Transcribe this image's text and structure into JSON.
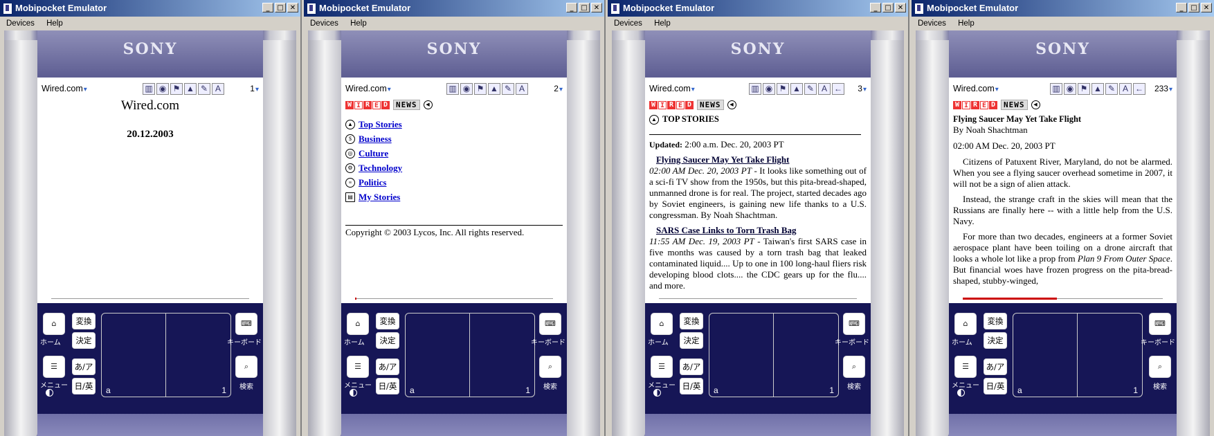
{
  "window_title": "Mobipocket Emulator",
  "window_controls": {
    "minimize": "_",
    "maximize": "□",
    "close": "✕"
  },
  "menu": [
    "Devices",
    "Help"
  ],
  "device_brand": "SONY",
  "book_title": "Wired.com",
  "pad": {
    "home": "ホーム",
    "convert": "変換",
    "decide": "決定",
    "keyboard": "キーボード",
    "kana": "あ/ア",
    "menu": "メニュー",
    "jp_en": "日/英",
    "search": "検索",
    "graffiti_left": "a",
    "graffiti_right": "1"
  },
  "screens": [
    {
      "page_num": "1",
      "cover_title": "Wired.com",
      "cover_date": "20.12.2003",
      "progress": 0.0
    },
    {
      "page_num": "2",
      "wired_letters": [
        "W",
        "I",
        "R",
        "E",
        "D"
      ],
      "news_label": "NEWS",
      "nav_items": [
        "Top Stories",
        "Business",
        "Culture",
        "Technology",
        "Politics",
        "My Stories"
      ],
      "copyright": "Copyright © 2003 Lycos, Inc. All rights reserved.",
      "progress": 0.005
    },
    {
      "page_num": "3",
      "news_label": "NEWS",
      "section_title": "TOP STORIES",
      "updated_label": "Updated:",
      "updated_value": "2:00 a.m. Dec. 20, 2003 PT",
      "stories": [
        {
          "headline": "Flying Saucer May Yet Take Flight",
          "time": "02:00 AM Dec. 20, 2003 PT",
          "text": " - It looks like something out of a sci-fi TV show from the 1950s, but this pita-bread-shaped, unmanned drone is for real. The project, started decades ago by Soviet engineers, is gaining new life thanks to a U.S. congressman. By Noah Shachtman."
        },
        {
          "headline": "SARS Case Links to Torn Trash Bag",
          "time": "11:55 AM Dec. 19, 2003 PT",
          "text": " - Taiwan's first SARS case in five months was caused by a torn trash bag that leaked contaminated liquid.... Up to one in 100 long-haul fliers risk developing blood clots.... the CDC gears up for the flu.... and more."
        }
      ],
      "progress": 0.01
    },
    {
      "page_num": "233",
      "news_label": "NEWS",
      "article_title": "Flying Saucer May Yet Take Flight",
      "byline": "By Noah Shachtman",
      "dateline": "02:00 AM Dec. 20, 2003 PT",
      "para1": "Citizens of Patuxent River, Maryland, do not be alarmed. When you see a flying saucer overhead sometime in 2007, it will not be a sign of alien attack.",
      "para2": "Instead, the strange craft in the skies will mean that the Russians are finally here -- with a little help from the U.S. Navy.",
      "para3_a": "For more than two decades, engineers at a former Soviet aerospace plant have been toiling on a drone aircraft that looks a whole lot like a prop from ",
      "para3_italic": "Plan 9 From Outer Space",
      "para3_b": ". But financial woes have frozen progress on the pita-bread-shaped, stubby-winged,",
      "progress": 0.49
    }
  ],
  "toolbar_icons_basic": [
    "library-icon",
    "globe-icon",
    "bookmark-icon",
    "chart-icon",
    "highlight-icon",
    "font-icon"
  ],
  "colors": {
    "titlebar_start": "#0a246a",
    "wired_red": "#e33",
    "pad_navy": "#161656",
    "link_blue": "#00c"
  }
}
